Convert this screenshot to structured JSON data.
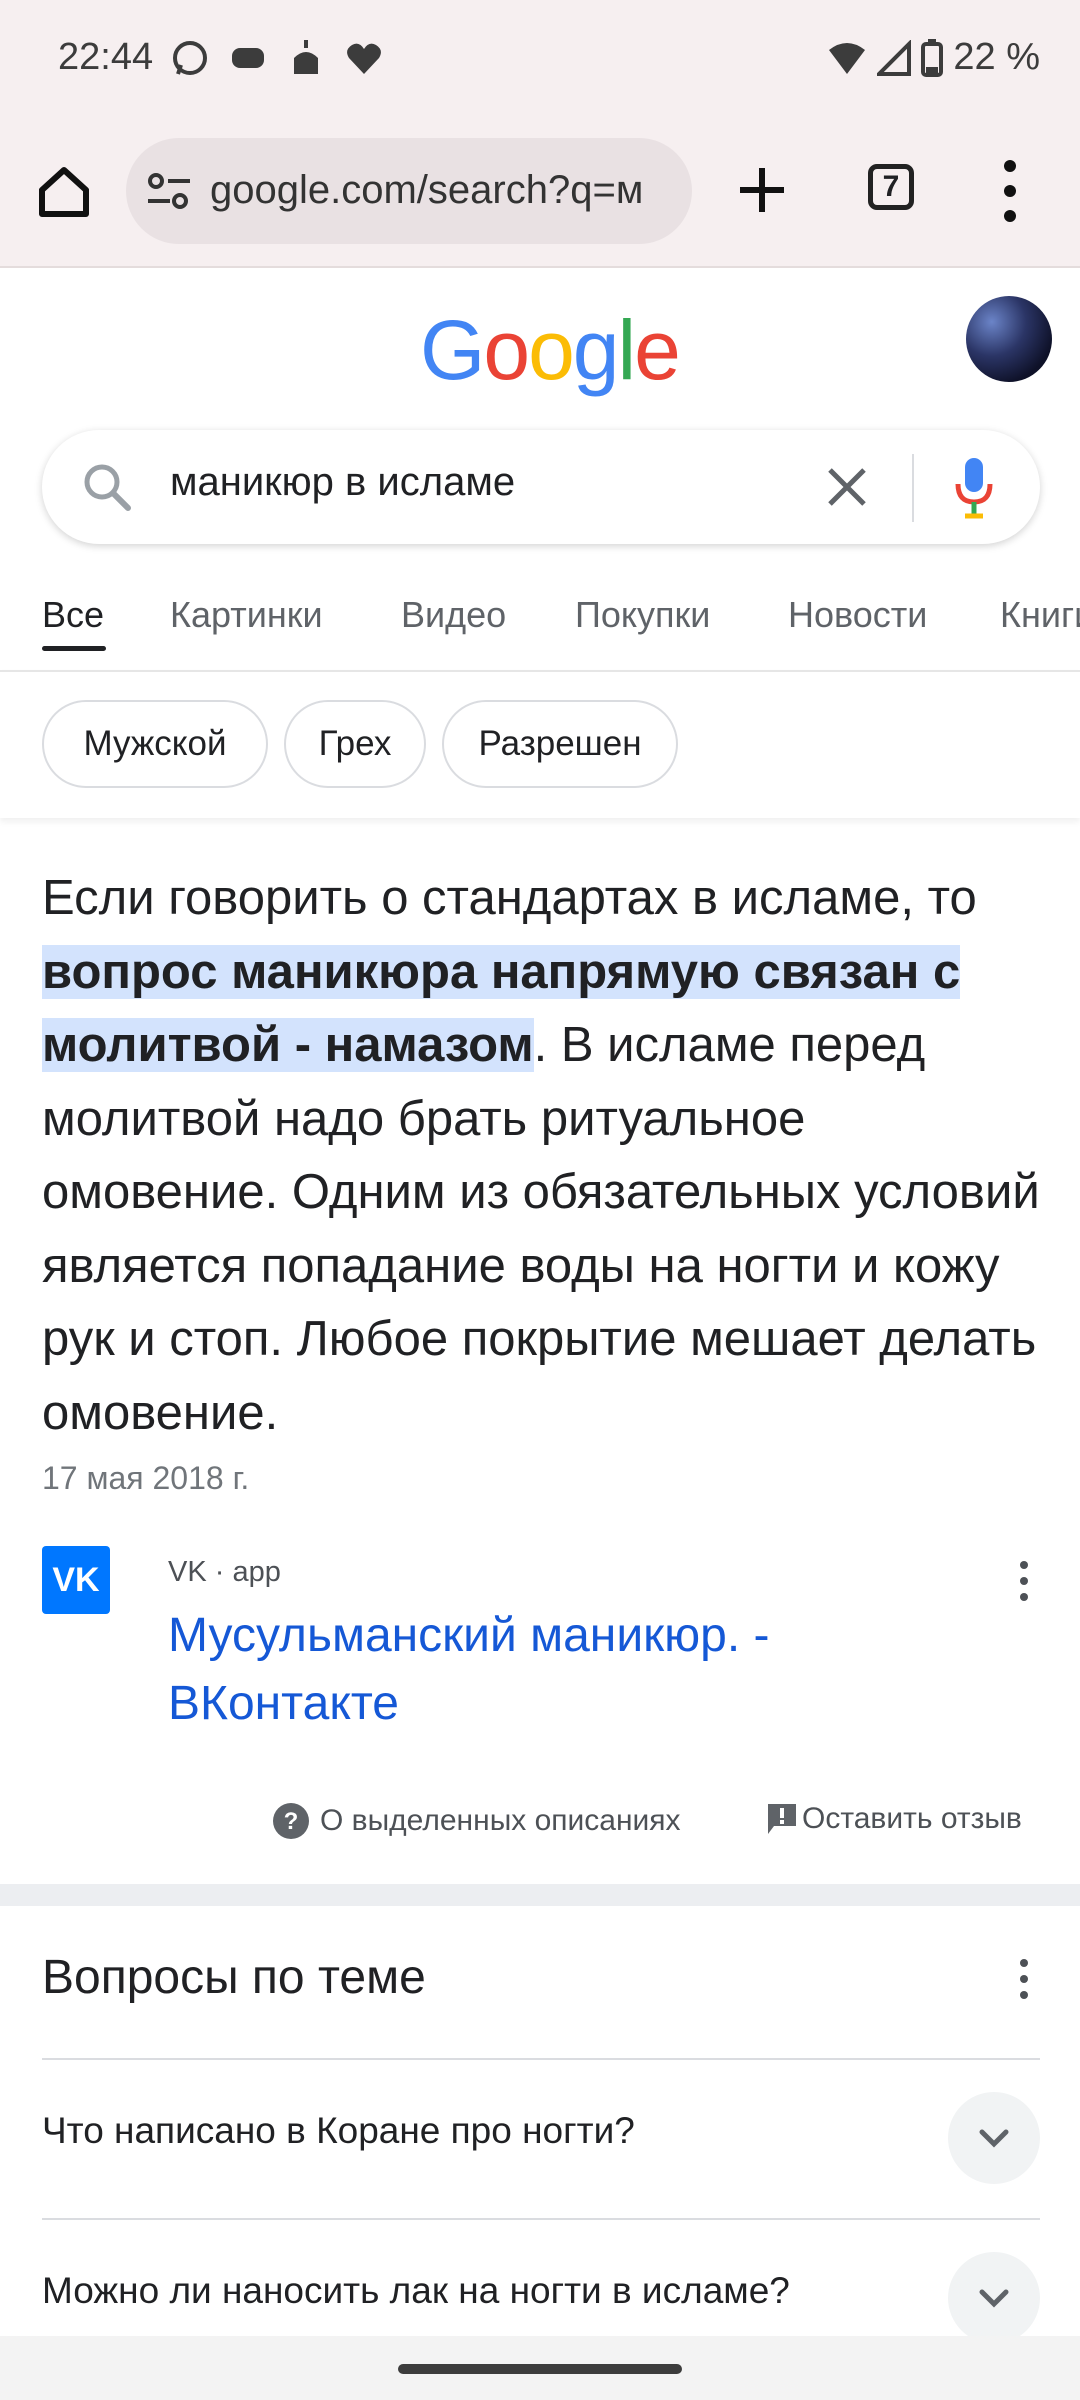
{
  "status_bar": {
    "time": "22:44",
    "battery": "22 %"
  },
  "browser": {
    "url": "google.com/search?q=м",
    "tab_count": "7"
  },
  "search": {
    "query": "маникюр в исламе"
  },
  "tabs": [
    "Все",
    "Картинки",
    "Видео",
    "Покупки",
    "Новости",
    "Книги"
  ],
  "chips": [
    "Мужской",
    "Грех",
    "Разрешен"
  ],
  "featured_snippet": {
    "text_before": "Если говорить о стандартах в исламе, то ",
    "highlight": "вопрос маникюра напрямую связан с молитвой - намазом",
    "text_after": ". В исламе перед молитвой надо брать ритуальное омовение. Одним из обязательных условий является попадание воды на ногти и кожу рук и стоп. Любое покрытие мешает делать омовение.",
    "date": "17 мая 2018 г.",
    "source": "VK · app",
    "title": "Мусульманский маникюр. - ВКонтакте",
    "about_label": "О выделенных описаниях",
    "feedback_label": "Оставить отзыв"
  },
  "related": {
    "title": "Вопросы по теме",
    "questions": [
      "Что написано в Коране про ногти?",
      "Можно ли наносить лак на ногти в исламе?"
    ]
  },
  "colors": {
    "link": "#1558d6",
    "highlight": "#d3e3fd",
    "browser_bg": "#f6eff0"
  }
}
